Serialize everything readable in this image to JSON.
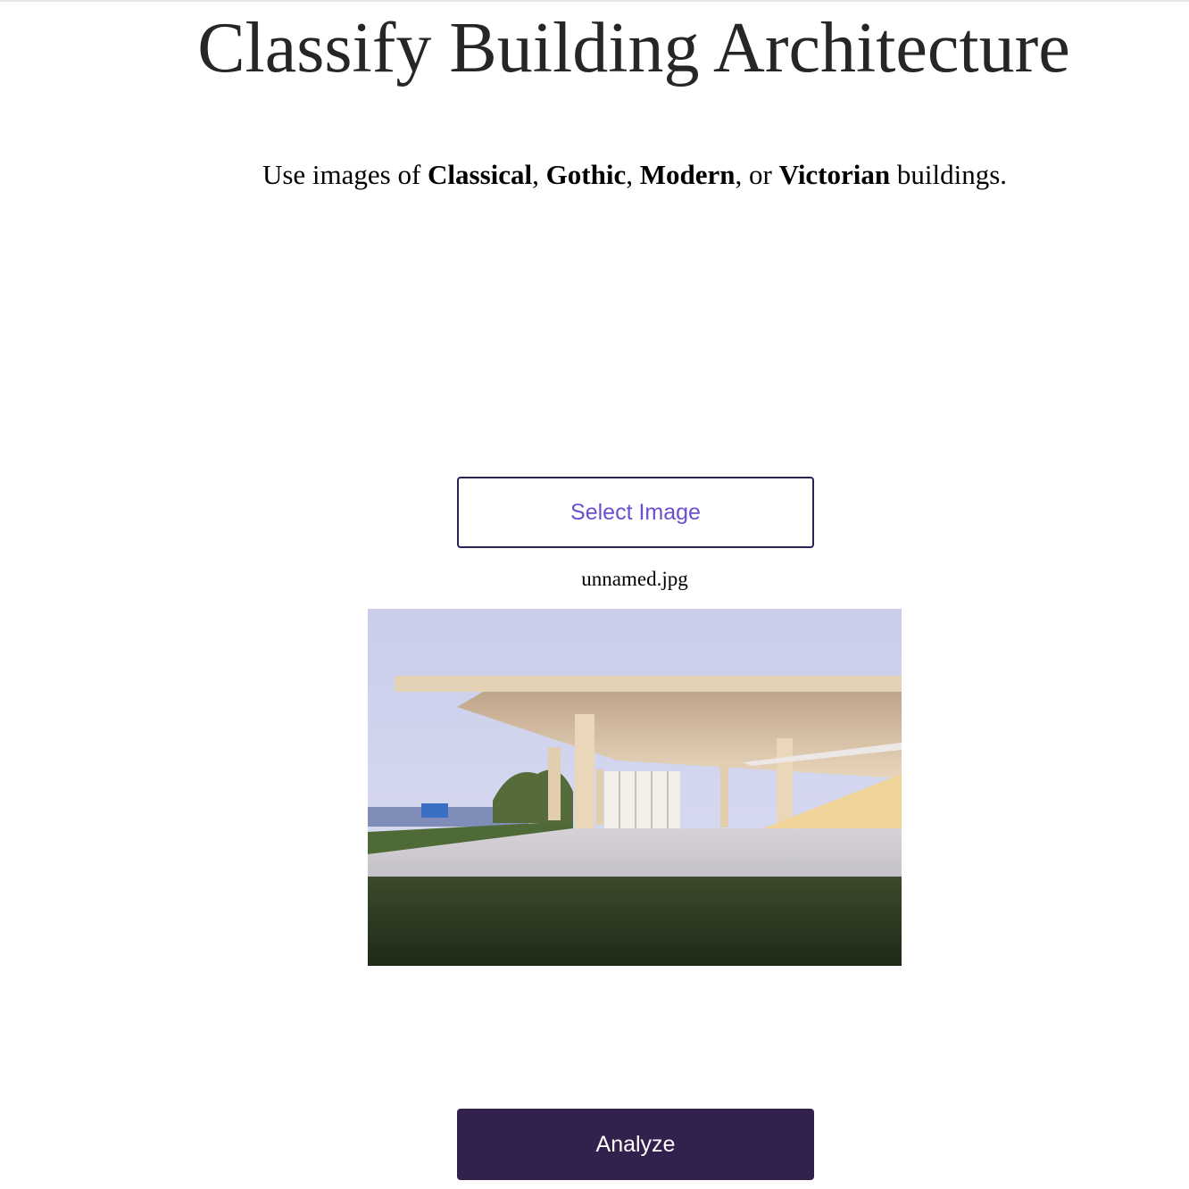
{
  "header": {
    "title": "Classify Building Architecture"
  },
  "instructions": {
    "prefix": "Use images of ",
    "styles": [
      "Classical",
      "Gothic",
      "Modern",
      "Victorian"
    ],
    "sep1": ", ",
    "sep2": ", ",
    "sep3": ", or ",
    "suffix": " buildings."
  },
  "upload": {
    "select_label": "Select Image",
    "file_name": "unnamed.jpg"
  },
  "actions": {
    "analyze_label": "Analyze"
  },
  "colors": {
    "accent": "#6a4fcf",
    "primary": "#32204d",
    "border": "#2e2250",
    "title_text": "#262626"
  }
}
